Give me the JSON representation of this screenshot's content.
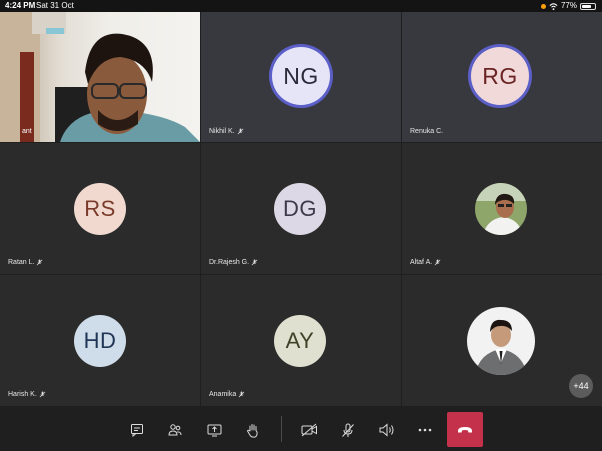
{
  "status_bar": {
    "time": "4:24 PM",
    "date": "Sat 31 Oct",
    "battery": "77%",
    "battery_level": 0.77
  },
  "participants": [
    {
      "label": "ant",
      "type": "video"
    },
    {
      "label": "Nikhil K.",
      "initials": "NG",
      "avatar_bg": "#e5e5f7",
      "initials_color": "#2a2a3a",
      "muted": true,
      "speaking": true
    },
    {
      "label": "Renuka C.",
      "initials": "RG",
      "avatar_bg": "#f1d9d9",
      "initials_color": "#6b2424",
      "muted": false,
      "speaking": true
    },
    {
      "label": "Ratan L.",
      "initials": "RS",
      "avatar_bg": "#f1d9d0",
      "initials_color": "#7a3b2a",
      "muted": true
    },
    {
      "label": "Dr.Rajesh G.",
      "initials": "DG",
      "avatar_bg": "#ddd8e6",
      "initials_color": "#3c3a4a",
      "muted": true
    },
    {
      "label": "Altaf A.",
      "type": "photo",
      "muted": true
    },
    {
      "label": "Harish K.",
      "initials": "HD",
      "avatar_bg": "#cfdcea",
      "initials_color": "#1f3556",
      "muted": true
    },
    {
      "label": "Anamika",
      "initials": "AY",
      "avatar_bg": "#dfe0cf",
      "initials_color": "#3e4229",
      "muted": true
    },
    {
      "label": "",
      "type": "photo"
    }
  ],
  "overflow_count": "+44",
  "toolbar": {
    "chat_icon": "chat-icon",
    "people_icon": "participants-icon",
    "share_icon": "share-screen-icon",
    "raise_hand_icon": "raise-hand-icon",
    "camera_icon": "camera-off-icon",
    "mic_icon": "mic-off-icon",
    "speaker_icon": "speaker-icon",
    "more_icon": "more-icon",
    "hangup_icon": "hang-up-icon",
    "hangup_color": "#c4314b"
  }
}
